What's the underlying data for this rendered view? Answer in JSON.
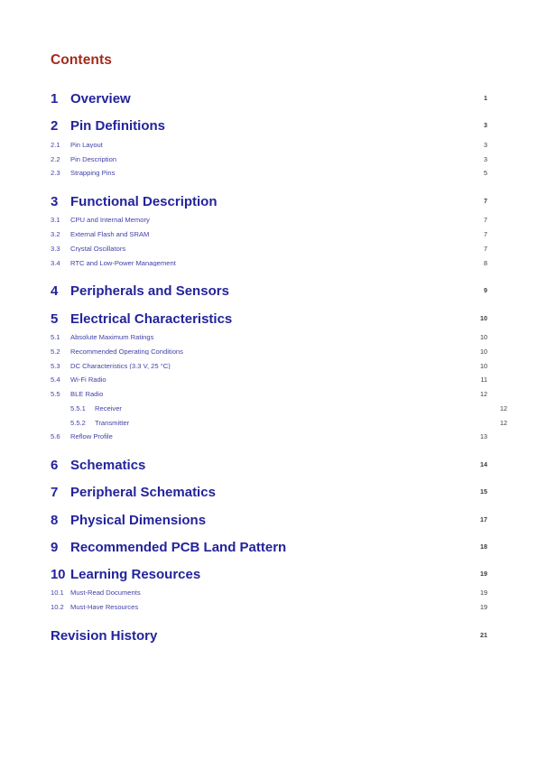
{
  "document": {
    "heading": "Contents",
    "heading_color": "#a32b1c",
    "section_color": "#23239c",
    "subsection_color": "#4242a8",
    "page_number_color": "#3a3a3a",
    "background_color": "#ffffff"
  },
  "entries": [
    {
      "level": 0,
      "number": "1",
      "title": "Overview",
      "page": "1"
    },
    {
      "level": 0,
      "number": "2",
      "title": "Pin Definitions",
      "page": "3"
    },
    {
      "level": 1,
      "number": "2.1",
      "title": "Pin Layout",
      "page": "3"
    },
    {
      "level": 1,
      "number": "2.2",
      "title": "Pin Description",
      "page": "3"
    },
    {
      "level": 1,
      "number": "2.3",
      "title": "Strapping Pins",
      "page": "5"
    },
    {
      "level": 0,
      "number": "3",
      "title": "Functional Description",
      "page": "7"
    },
    {
      "level": 1,
      "number": "3.1",
      "title": "CPU and Internal Memory",
      "page": "7"
    },
    {
      "level": 1,
      "number": "3.2",
      "title": "External Flash and SRAM",
      "page": "7"
    },
    {
      "level": 1,
      "number": "3.3",
      "title": "Crystal Oscillators",
      "page": "7"
    },
    {
      "level": 1,
      "number": "3.4",
      "title": "RTC and Low-Power Management",
      "page": "8"
    },
    {
      "level": 0,
      "number": "4",
      "title": "Peripherals and Sensors",
      "page": "9"
    },
    {
      "level": 0,
      "number": "5",
      "title": "Electrical Characteristics",
      "page": "10"
    },
    {
      "level": 1,
      "number": "5.1",
      "title": "Absolute Maximum Ratings",
      "page": "10"
    },
    {
      "level": 1,
      "number": "5.2",
      "title": "Recommended Operating Conditions",
      "page": "10"
    },
    {
      "level": 1,
      "number": "5.3",
      "title": "DC Characteristics (3.3 V, 25 °C)",
      "page": "10"
    },
    {
      "level": 1,
      "number": "5.4",
      "title": "Wi-Fi Radio",
      "page": "11"
    },
    {
      "level": 1,
      "number": "5.5",
      "title": "BLE Radio",
      "page": "12"
    },
    {
      "level": 2,
      "number": "5.5.1",
      "title": "Receiver",
      "page": "12"
    },
    {
      "level": 2,
      "number": "5.5.2",
      "title": "Transmitter",
      "page": "12"
    },
    {
      "level": 1,
      "number": "5.6",
      "title": "Reflow Profile",
      "page": "13"
    },
    {
      "level": 0,
      "number": "6",
      "title": "Schematics",
      "page": "14"
    },
    {
      "level": 0,
      "number": "7",
      "title": "Peripheral Schematics",
      "page": "15"
    },
    {
      "level": 0,
      "number": "8",
      "title": "Physical Dimensions",
      "page": "17"
    },
    {
      "level": 0,
      "number": "9",
      "title": "Recommended PCB Land Pattern",
      "page": "18"
    },
    {
      "level": 0,
      "number": "10",
      "title": "Learning Resources",
      "page": "19"
    },
    {
      "level": 1,
      "number": "10.1",
      "title": "Must-Read Documents",
      "page": "19"
    },
    {
      "level": 1,
      "number": "10.2",
      "title": "Must-Have Resources",
      "page": "19"
    },
    {
      "level": 0,
      "number": "",
      "title": "Revision History",
      "page": "21"
    }
  ]
}
